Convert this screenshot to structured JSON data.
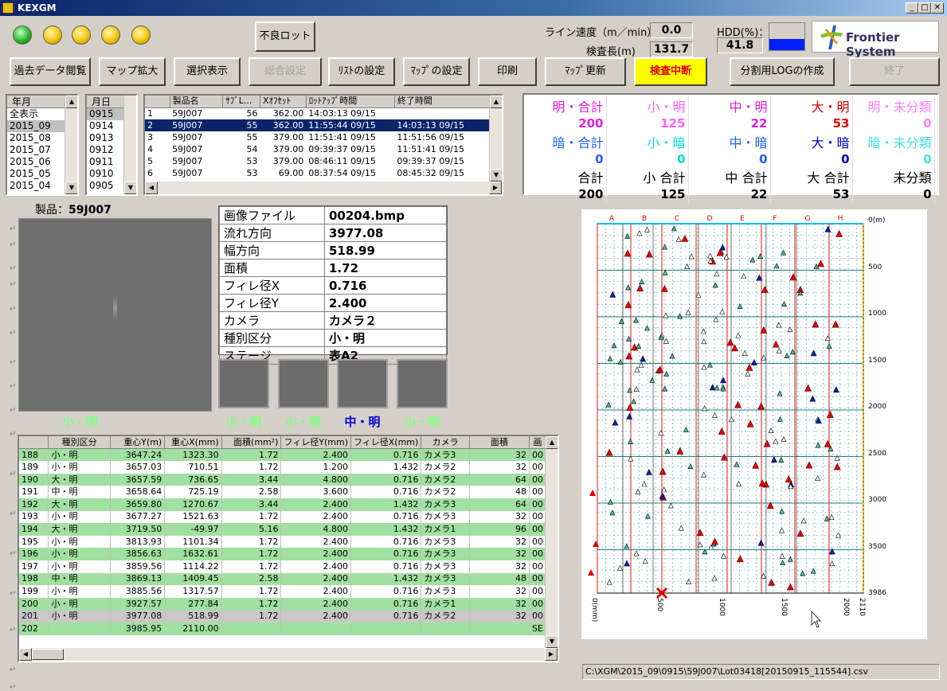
{
  "window": {
    "title": "KEXGM"
  },
  "top": {
    "defect_lot_label": "不良ロット",
    "line_speed_label": "ライン速度（m／min）",
    "line_speed_value": "0.0",
    "inspect_length_label": "検査長(m)",
    "inspect_length_value": "131.7",
    "hdd_label": "HDD(%)：",
    "hdd_value": "41.8",
    "logo_text": "Frontier System"
  },
  "leds": [
    "green",
    "yellow",
    "yellow",
    "yellow",
    "yellow"
  ],
  "toolbar": {
    "past_data": "過去データ閲覧",
    "map_zoom": "マップ拡大",
    "select_view": "選択表示",
    "general_settings": "総合設定",
    "list_settings": "ﾘｽﾄの設定",
    "map_settings": "ﾏｯﾌﾟの設定",
    "print": "印刷",
    "map_update": "ﾏｯﾌﾟ更新",
    "inspect_stop": "検査中断",
    "split_log": "分割用LOGの作成",
    "exit": "終了"
  },
  "year_list": {
    "header": "年月",
    "items": [
      "全表示",
      "2015_09",
      "2015_08",
      "2015_07",
      "2015_06",
      "2015_05",
      "2015_04"
    ],
    "selected": 1
  },
  "day_list": {
    "header": "月日",
    "items": [
      "0915",
      "0914",
      "0913",
      "0912",
      "0911",
      "0910",
      "0905"
    ],
    "selected": 0
  },
  "product_list": {
    "headers": [
      "",
      "製品名",
      "ｻﾌﾞL...",
      "Xｵﾌｾｯﾄ",
      "ﾛｯﾄｱｯﾌﾟ時間",
      "終了時間"
    ],
    "rows": [
      [
        "1",
        "59J007",
        "56",
        "362.00",
        "14:03:13 09/15",
        ""
      ],
      [
        "2",
        "59J007",
        "55",
        "362.00",
        "11:55:44 09/15",
        "14:03:13 09/15"
      ],
      [
        "3",
        "59J007",
        "55",
        "379.00",
        "11:51:41 09/15",
        "11:51:56 09/15"
      ],
      [
        "4",
        "59J007",
        "54",
        "379.00",
        "09:39:37 09/15",
        "11:51:41 09/15"
      ],
      [
        "5",
        "59J007",
        "53",
        "379.00",
        "08:46:11 09/15",
        "09:39:37 09/15"
      ],
      [
        "6",
        "59J007",
        "53",
        "69.00",
        "08:37:54 09/15",
        "08:45:32 09/15"
      ]
    ],
    "selected": 1
  },
  "stats": {
    "rows": [
      {
        "labels": [
          "明・合計",
          "小・明",
          "中・明",
          "大・明",
          "明・未分類"
        ],
        "values": [
          "200",
          "125",
          "22",
          "53",
          "0"
        ],
        "colors": [
          "#e020e0",
          "#ff60ff",
          "#e020e0",
          "#e00000",
          "#ff80ff"
        ]
      },
      {
        "labels": [
          "暗・合計",
          "小・暗",
          "中・暗",
          "大・暗",
          "暗・未分類"
        ],
        "values": [
          "0",
          "0",
          "0",
          "0",
          "0"
        ],
        "colors": [
          "#2060ff",
          "#00e0e0",
          "#2060ff",
          "#0000c0",
          "#40e0e0"
        ]
      },
      {
        "labels": [
          "合計",
          "小 合計",
          "中 合計",
          "大 合計",
          "未分類"
        ],
        "values": [
          "200",
          "125",
          "22",
          "53",
          "0"
        ],
        "colors": [
          "#000",
          "#000",
          "#000",
          "#000",
          "#000"
        ]
      }
    ]
  },
  "product": {
    "label": "製品：",
    "name": "59J007"
  },
  "image_label": "小・明",
  "info": [
    [
      "画像ファイル",
      "00204.bmp"
    ],
    [
      "流れ方向",
      "3977.08"
    ],
    [
      "幅方向",
      "518.99"
    ],
    [
      "面積",
      "1.72"
    ],
    [
      "フィレ径X",
      "0.716"
    ],
    [
      "フィレ径Y",
      "2.400"
    ],
    [
      "カメラ",
      "カメラ２"
    ],
    [
      "種別区分",
      "小・明"
    ],
    [
      "ステージ",
      "表A2"
    ]
  ],
  "thumbs": [
    {
      "label": "小・明",
      "color": "#80ff80"
    },
    {
      "label": "小・明",
      "color": "#80ff80"
    },
    {
      "label": "中・明",
      "color": "#0000e0"
    },
    {
      "label": "小・明",
      "color": "#80ff80"
    }
  ],
  "defects": {
    "headers": [
      "",
      "種別区分",
      "重心Y(m)",
      "重心X(mm)",
      "面積(mm²)",
      "フィレ径Y(mm)",
      "フィレ径X(mm)",
      "カメラ",
      "面積",
      "画"
    ],
    "rows": [
      [
        "188",
        "小・明",
        "3647.24",
        "1323.30",
        "1.72",
        "2.400",
        "0.716",
        "カメラ3",
        "32",
        "00",
        "g"
      ],
      [
        "189",
        "小・明",
        "3657.03",
        "710.51",
        "1.72",
        "1.200",
        "1.432",
        "カメラ2",
        "32",
        "00",
        "w"
      ],
      [
        "190",
        "大・明",
        "3657.59",
        "736.65",
        "3.44",
        "4.800",
        "0.716",
        "カメラ2",
        "64",
        "00",
        "g"
      ],
      [
        "191",
        "中・明",
        "3658.64",
        "725.19",
        "2.58",
        "3.600",
        "0.716",
        "カメラ2",
        "48",
        "00",
        "w"
      ],
      [
        "192",
        "大・明",
        "3659.80",
        "1270.67",
        "3.44",
        "2.400",
        "1.432",
        "カメラ3",
        "64",
        "00",
        "g"
      ],
      [
        "193",
        "小・明",
        "3677.27",
        "1521.63",
        "1.72",
        "2.400",
        "0.716",
        "カメラ3",
        "32",
        "00",
        "w"
      ],
      [
        "194",
        "大・明",
        "3719.50",
        "-49.97",
        "5.16",
        "4.800",
        "1.432",
        "カメラ1",
        "96",
        "00",
        "g"
      ],
      [
        "195",
        "小・明",
        "3813.93",
        "1101.34",
        "1.72",
        "2.400",
        "0.716",
        "カメラ3",
        "32",
        "00",
        "w"
      ],
      [
        "196",
        "小・明",
        "3856.63",
        "1632.61",
        "1.72",
        "2.400",
        "0.716",
        "カメラ3",
        "32",
        "00",
        "g"
      ],
      [
        "197",
        "小・明",
        "3859.56",
        "1114.22",
        "1.72",
        "2.400",
        "0.716",
        "カメラ3",
        "32",
        "00",
        "w"
      ],
      [
        "198",
        "中・明",
        "3869.13",
        "1409.45",
        "2.58",
        "2.400",
        "1.432",
        "カメラ3",
        "48",
        "00",
        "g"
      ],
      [
        "199",
        "小・明",
        "3885.56",
        "1317.57",
        "1.72",
        "2.400",
        "0.716",
        "カメラ3",
        "32",
        "00",
        "w"
      ],
      [
        "200",
        "小・明",
        "3927.57",
        "277.84",
        "1.72",
        "2.400",
        "0.716",
        "カメラ1",
        "32",
        "00",
        "g"
      ],
      [
        "201",
        "小・明",
        "3977.08",
        "518.99",
        "1.72",
        "2.400",
        "0.716",
        "カメラ2",
        "32",
        "00",
        "gr"
      ],
      [
        "202",
        "",
        "3985.95",
        "2110.00",
        "",
        "",
        "",
        "",
        "",
        "SE",
        "g"
      ]
    ]
  },
  "map": {
    "columns": [
      "A",
      "B",
      "C",
      "D",
      "E",
      "F",
      "G",
      "H"
    ],
    "y_unit": "0(m)",
    "y_ticks": [
      "500",
      "1000",
      "1500",
      "2000",
      "2500",
      "3000",
      "3500",
      "3986"
    ],
    "x_unit": "0(mm)",
    "x_ticks": [
      "500",
      "1000",
      "1500",
      "2000",
      "2110"
    ]
  },
  "status_path": "C:\\XGM\\2015_09\\0915\\59J007\\Lot03418[20150915_115544].csv"
}
